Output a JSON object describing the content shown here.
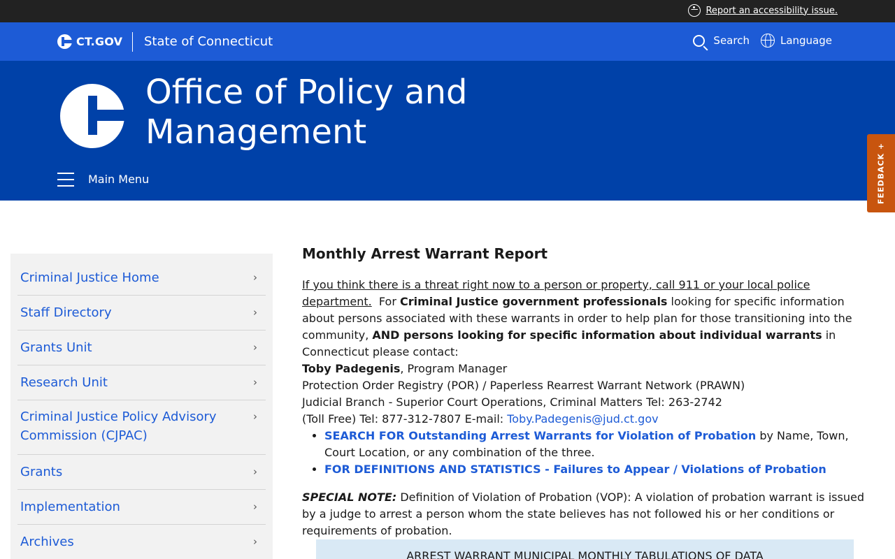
{
  "topbar": {
    "accessibility_link": "Report an accessibility issue."
  },
  "govbar": {
    "logo_text": "CT.GOV",
    "state_name": "State of Connecticut",
    "search_label": "Search",
    "language_label": "Language"
  },
  "hero": {
    "office_title": "Office of Policy and Management",
    "main_menu_label": "Main Menu"
  },
  "feedback": {
    "label": "FEEDBACK +"
  },
  "sidebar": {
    "items": [
      {
        "label": "Criminal Justice Home"
      },
      {
        "label": "Staff Directory"
      },
      {
        "label": "Grants Unit"
      },
      {
        "label": "Research Unit"
      },
      {
        "label": "Criminal Justice Policy Advisory Commission (CJPAC)"
      },
      {
        "label": "Grants"
      },
      {
        "label": "Implementation"
      },
      {
        "label": "Archives"
      }
    ],
    "chevron": "›"
  },
  "content": {
    "heading": "Monthly Arrest Warrant Report",
    "threat_link": "If you think there is a threat right now to a person or property, call 911 or your local police department.",
    "intro_1": "For",
    "intro_bold_1": "Criminal Justice government professionals",
    "intro_2": "looking for specific information about persons associated with these warrants in order to help plan for those transitioning into the community,",
    "intro_bold_2": "AND persons looking for specific information about individual warrants",
    "intro_3": "in Connecticut please contact:",
    "contact_name": "Toby Padegenis",
    "contact_role": ", Program Manager",
    "contact_line_2": "Protection Order Registry (POR) / Paperless Rearrest Warrant Network (PRAWN)",
    "contact_line_3": "Judicial Branch - Superior Court Operations, Criminal Matters Tel:  263-2742",
    "contact_line_4": "(Toll Free) Tel: 877-312-7807 E-mail:",
    "contact_email": "Toby.Padegenis@jud.ct.gov",
    "bullet_1_link": "SEARCH FOR Outstanding Arrest Warrants for Violation of Probation",
    "bullet_1_text": "by Name, Town, Court Location, or any combination of the three.",
    "bullet_2_link": "FOR DEFINITIONS AND STATISTICS - Failures to Appear / Violations of Probation",
    "note_label": "SPECIAL NOTE:",
    "note_text": "Definition of Violation of Probation (VOP): A violation of probation warrant is issued by a judge to arrest a person whom the state believes has not followed his or her conditions or requirements of probation.",
    "table_header": "ARREST WARRANT MUNICIPAL MONTHLY TABULATIONS OF DATA"
  }
}
